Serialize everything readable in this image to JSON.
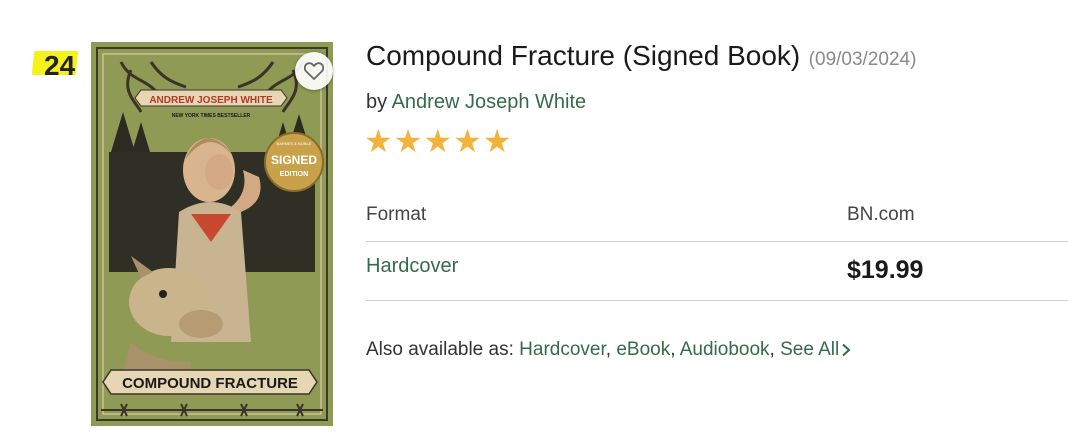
{
  "rank": "24",
  "product": {
    "title": "Compound Fracture (Signed Book)",
    "pub_date": "(09/03/2024)",
    "by_label": "by",
    "author": "Andrew Joseph White",
    "rating": 5,
    "rating_max": 5
  },
  "cover": {
    "author_banner": "ANDREW JOSEPH WHITE",
    "tagline": "NEW YORK TIMES BESTSELLER",
    "seal_top": "BARNES & NOBLE",
    "seal_line1": "SIGNED",
    "seal_line2": "EDITION",
    "title_banner": "COMPOUND FRACTURE",
    "colors": {
      "background": "#8f9a55",
      "banner": "#e7d6b4",
      "author_banner_text": "#b23a2a",
      "seal": "#c9a14a"
    }
  },
  "wishlist": {
    "icon": "heart-icon"
  },
  "format_table": {
    "col_format": "Format",
    "col_source": "BN.com",
    "row": {
      "format": "Hardcover",
      "price": "$19.99"
    }
  },
  "also_available": {
    "label": "Also available as:",
    "formats": [
      "Hardcover",
      "eBook",
      "Audiobook"
    ],
    "see_all": "See All",
    "see_all_icon": "chevron-right-icon"
  },
  "colors": {
    "link": "#346b4a",
    "star": "#f1b33a",
    "rank_highlight": "#f4f21a"
  }
}
